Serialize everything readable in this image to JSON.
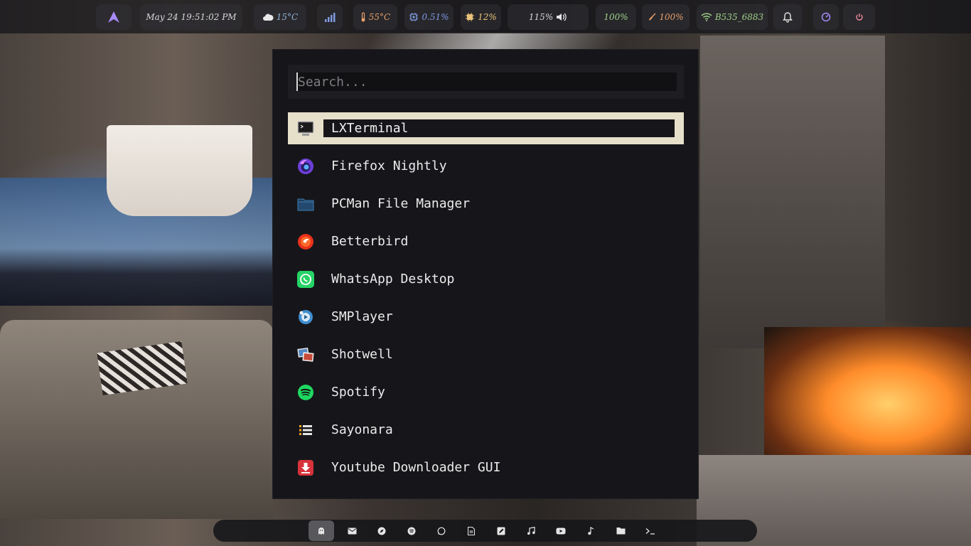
{
  "topbar": {
    "datetime": "May 24 19:51:02 PM",
    "weather": "15°C",
    "temperature": "55°C",
    "cpu": "0.51%",
    "memory": "12%",
    "volume": "115%",
    "brightness": "100%",
    "battery": "100%",
    "wifi": "B535_6883",
    "colors": {
      "launcher": "#a78bfa",
      "weather": "#8fb3d9",
      "temperature": "#e6a06b",
      "cpu": "#7f9be0",
      "memory": "#e8c27a",
      "volume": "#e5e5e5",
      "brightness": "#9fd08a",
      "battery": "#e6a06b",
      "wifi": "#9fd08a",
      "notification": "#e5e5e5",
      "dashboard": "#a78bfa",
      "power": "#f08aa0"
    }
  },
  "launcher": {
    "search_placeholder": "Search...",
    "selected_index": 0,
    "apps": [
      {
        "label": "LXTerminal",
        "icon": "terminal-icon"
      },
      {
        "label": "Firefox Nightly",
        "icon": "firefox-nightly-icon"
      },
      {
        "label": "PCMan File Manager",
        "icon": "folder-icon"
      },
      {
        "label": "Betterbird",
        "icon": "betterbird-icon"
      },
      {
        "label": "WhatsApp Desktop",
        "icon": "whatsapp-icon"
      },
      {
        "label": "SMPlayer",
        "icon": "smplayer-icon"
      },
      {
        "label": "Shotwell",
        "icon": "shotwell-icon"
      },
      {
        "label": "Spotify",
        "icon": "spotify-icon"
      },
      {
        "label": "Sayonara",
        "icon": "sayonara-icon"
      },
      {
        "label": "Youtube Downloader GUI",
        "icon": "youtube-downloader-icon"
      }
    ]
  },
  "dock": {
    "items": [
      {
        "icon": "ghost-icon",
        "active": true
      },
      {
        "icon": "mail-icon",
        "active": false
      },
      {
        "icon": "compass-icon",
        "active": false
      },
      {
        "icon": "spotify-icon",
        "active": false
      },
      {
        "icon": "whatsapp-icon",
        "active": false
      },
      {
        "icon": "document-icon",
        "active": false
      },
      {
        "icon": "edit-icon",
        "active": false
      },
      {
        "icon": "music-note-icon",
        "active": false
      },
      {
        "icon": "youtube-icon",
        "active": false
      },
      {
        "icon": "music-icon",
        "active": false
      },
      {
        "icon": "folder-icon",
        "active": false
      },
      {
        "icon": "terminal-prompt-icon",
        "active": false
      }
    ]
  }
}
